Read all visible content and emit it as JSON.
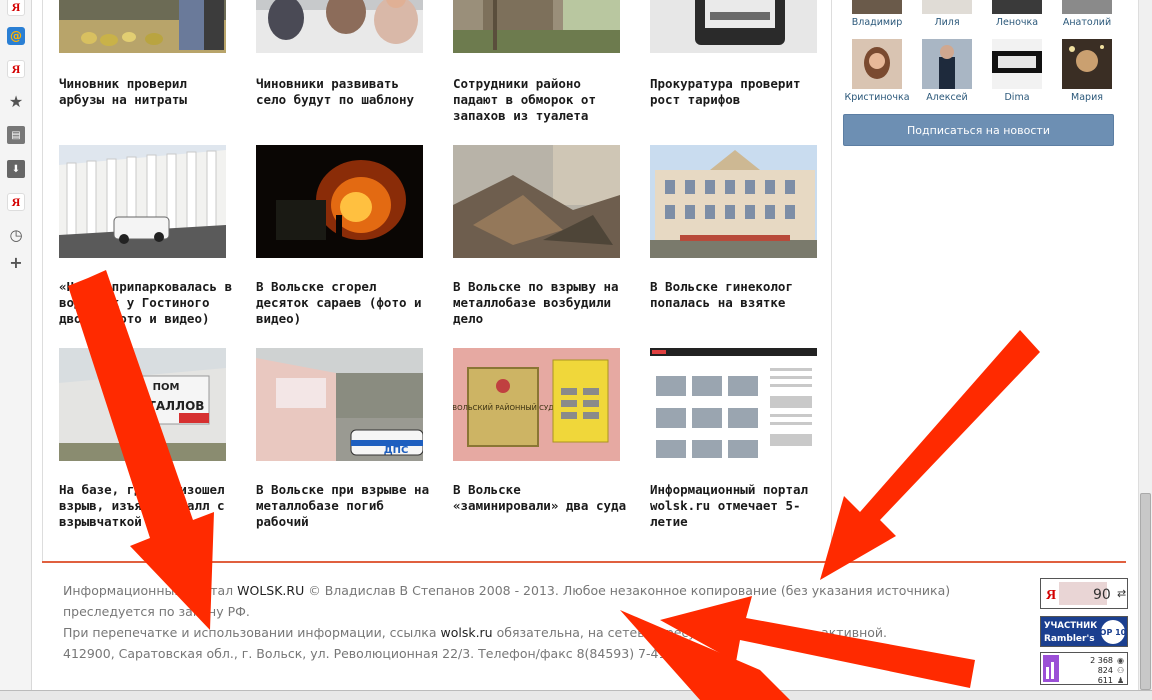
{
  "colors": {
    "accent": "#e0603f",
    "link": "#2b587a",
    "arrow": "#ff2a00",
    "subscribe": "#6d8fb3"
  },
  "sidebar": {
    "icons": [
      "yandex-icon",
      "mail-icon",
      "yandex-icon",
      "star-icon",
      "notes-icon",
      "download-icon",
      "yandex-icon",
      "history-icon",
      "add-icon"
    ]
  },
  "news": [
    {
      "caption": "Чиновник проверил арбузы на нитраты"
    },
    {
      "caption": "Чиновники развивать село будут по шаблону"
    },
    {
      "caption": "Сотрудники районо падают в обморок от запахов из туалета"
    },
    {
      "caption": "Прокуратура проверит рост тарифов"
    },
    {
      "caption": "«Нива» припарковалась в водосток у Гостиного двора (фото и видео)"
    },
    {
      "caption": "В Вольске сгорел десяток сараев (фото и видео)"
    },
    {
      "caption": "В Вольске по взрыву на металлобазе возбудили дело"
    },
    {
      "caption": "В Вольске гинеколог попалась на взятке"
    },
    {
      "caption": "На базе, где произошел взрыв, изъяли металл с взрывчаткой"
    },
    {
      "caption": "В Вольске при взрыве на металлобазе погиб рабочий"
    },
    {
      "caption": "В Вольске «заминировали» два суда"
    },
    {
      "caption": "Информационный портал wolsk.ru отмечает 5-летие"
    }
  ],
  "thumb_text": {
    "sign1": "ПОМ",
    "sign2": "МЕТАЛЛОВ",
    "court": "ВОЛЬСКИЙ РАЙОННЫЙ СУД",
    "police": "ДПС"
  },
  "friends": {
    "row1": [
      "Владимир",
      "Лиля",
      "Леночка",
      "Анатолий"
    ],
    "row2": [
      "Кристиночка",
      "Алексей",
      "Dima",
      "Мария"
    ]
  },
  "subscribe_label": "Подписаться на новости",
  "footer": {
    "line1_a": "Информационный портал ",
    "line1_link": "WOLSK.RU",
    "line1_b": " © Владислав В Степанов 2008 - 2013. Любое незаконное копирование (без указания источника) преследуется по закону РФ.",
    "line2_a": "При перепечатке и использовании информации, ссылка ",
    "line2_link": "wolsk.ru",
    "line2_b": " обязательна, на сетевых ресурсах должна быть активной.",
    "line3": "412900, Саратовская обл., г. Вольск, ул. Революционная 22/3. Телефон/факс 8(84593) 7-41-75"
  },
  "counters": {
    "yandex": {
      "letter": "Я",
      "value": "90"
    },
    "rambler": {
      "top": "УЧАСТНИК",
      "brand": "Rambler's",
      "badge": "TOP 100"
    },
    "liveinternet": {
      "views": "2 368",
      "visitors": "824",
      "online": "611"
    }
  }
}
